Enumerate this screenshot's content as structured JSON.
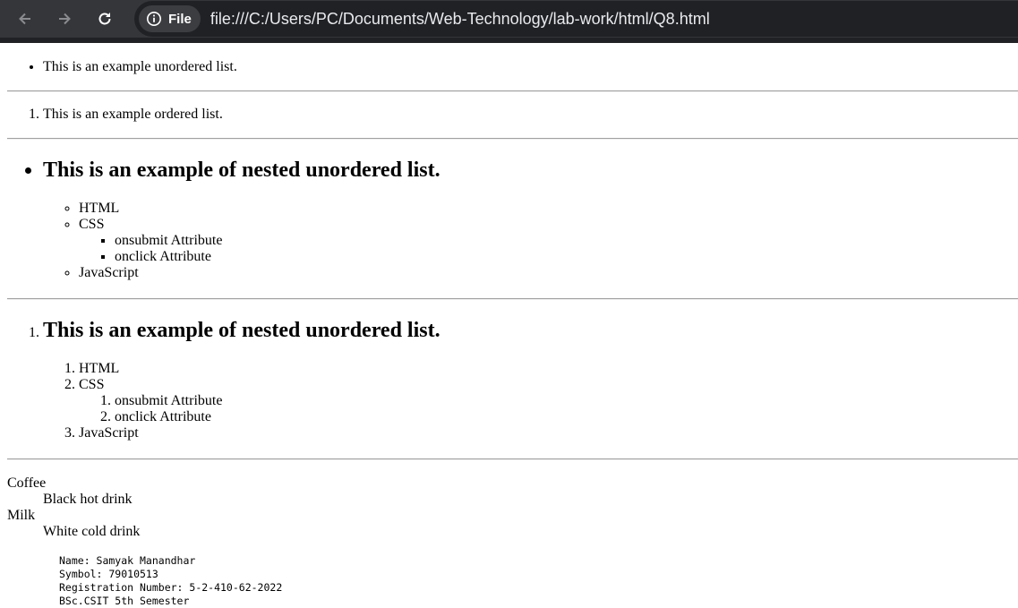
{
  "browser": {
    "back_icon": "arrow-left-icon",
    "forward_icon": "arrow-right-icon",
    "reload_icon": "reload-icon",
    "site_info_icon": "info-icon",
    "site_label": "File",
    "url": "file:///C:/Users/PC/Documents/Web-Technology/lab-work/html/Q8.html"
  },
  "unordered_list": [
    "This is an example unordered list."
  ],
  "ordered_list": [
    "This is an example ordered list."
  ],
  "nested_unordered": {
    "heading": "This is an example of nested unordered list.",
    "items": [
      "HTML",
      "CSS",
      "JavaScript"
    ],
    "css_children": [
      "onsubmit Attribute",
      "onclick Attribute"
    ]
  },
  "nested_ordered": {
    "heading": "This is an example of nested unordered list.",
    "items": [
      "HTML",
      "CSS",
      "JavaScript"
    ],
    "css_children": [
      "onsubmit Attribute",
      "onclick Attribute"
    ]
  },
  "definition_list": [
    {
      "term": "Coffee",
      "desc": "Black hot drink"
    },
    {
      "term": "Milk",
      "desc": "White cold drink"
    }
  ],
  "preformatted": {
    "line1": "Name: Samyak Manandhar",
    "line2": "Symbol: 79010513",
    "line3": "Registration Number: 5-2-410-62-2022",
    "line4": "BSc.CSIT 5th Semester"
  }
}
